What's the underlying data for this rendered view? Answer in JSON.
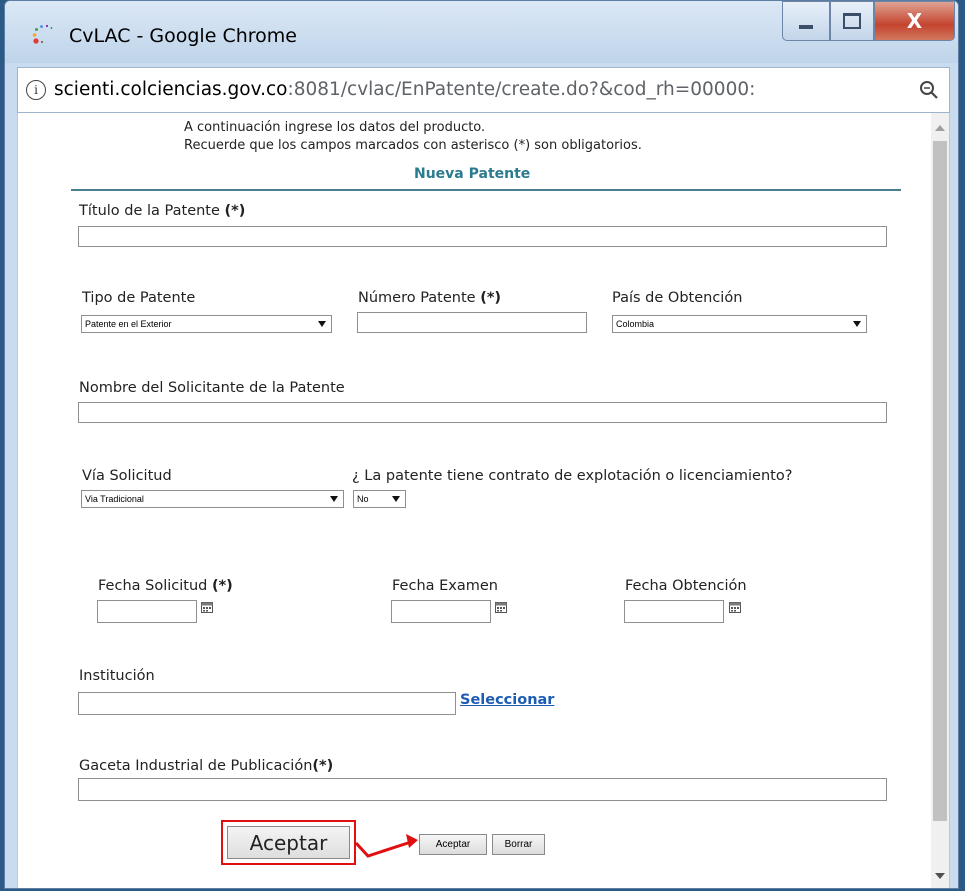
{
  "window": {
    "title": "CvLAC - Google Chrome",
    "close_glyph": "X"
  },
  "address": {
    "host": "scienti.colciencias.gov.co",
    "path": ":8081/cvlac/EnPatente/create.do?&cod_rh=00000:"
  },
  "intro": {
    "line1": "A continuación ingrese los datos del producto.",
    "line2": "Recuerde que los campos marcados con asterisco (*) son obligatorios."
  },
  "form": {
    "heading": "Nueva Patente",
    "required_mark": "(*)",
    "titulo_label": "Título de la Patente ",
    "tipo_label": "Tipo de Patente",
    "tipo_value": "Patente en el Exterior",
    "numero_label": "Número Patente ",
    "pais_label": "País de Obtención",
    "pais_value": "Colombia",
    "solicitante_label": "Nombre del Solicitante de la Patente",
    "via_label": "Vía Solicitud",
    "via_value": "Via Tradicional",
    "contrato_label": "¿ La patente tiene contrato de explotación o licenciamiento?",
    "contrato_value": "No",
    "fecha_solicitud_label": "Fecha Solicitud ",
    "fecha_examen_label": "Fecha Examen",
    "fecha_obtencion_label": "Fecha Obtención",
    "institucion_label": "Institución",
    "seleccionar_link": "Seleccionar",
    "gaceta_label": "Gaceta Industrial de Publicación",
    "gaceta_req": "(*)"
  },
  "buttons": {
    "aceptar_zoom": "Aceptar",
    "aceptar": "Aceptar",
    "borrar": "Borrar"
  },
  "colors": {
    "heading": "#2b7b8e",
    "link": "#1d5cb3",
    "highlight": "#e01010"
  },
  "icons": [
    "app-icon",
    "minimize-icon",
    "maximize-icon",
    "close-icon",
    "info-icon",
    "zoom-icon",
    "calendar-icon"
  ]
}
